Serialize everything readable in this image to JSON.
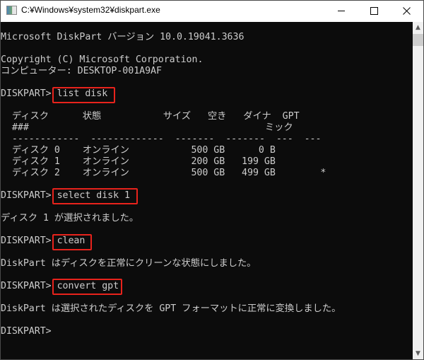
{
  "window": {
    "title": "C:¥Windows¥system32¥diskpart.exe",
    "icon": "console-app-icon",
    "controls": {
      "minimize": "minimize-icon",
      "maximize": "maximize-icon",
      "close": "close-icon"
    }
  },
  "console": {
    "lines": {
      "version": "Microsoft DiskPart バージョン 10.0.19041.3636",
      "copyright": "Copyright (C) Microsoft Corporation.",
      "computer": "コンピューター: DESKTOP-001A9AF",
      "prompt": "DISKPART> ",
      "table_header1": "  ディスク      状態           サイズ   空き   ダイナ  GPT",
      "table_header2": "  ###                                          ミック",
      "table_sep": "  ------------  -------------  -------  -------  ---  ---",
      "row0": "  ディスク 0    オンライン           500 GB      0 B",
      "row1": "  ディスク 1    オンライン           200 GB   199 GB",
      "row2": "  ディスク 2    オンライン           500 GB   499 GB        *",
      "select_result": "ディスク 1 が選択されました。",
      "clean_result": "DiskPart はディスクを正常にクリーンな状態にしました。",
      "convert_result": "DiskPart は選択されたディスクを GPT フォーマットに正常に変換しました。"
    },
    "commands": [
      "list disk",
      "select disk 1",
      "clean",
      "convert gpt"
    ],
    "disks": {
      "columns": [
        "ディスク ###",
        "状態",
        "サイズ",
        "空き",
        "ダイナミック",
        "GPT"
      ],
      "rows": [
        {
          "disk": "ディスク 0",
          "status": "オンライン",
          "size": "500 GB",
          "free": "0 B",
          "dyn": "",
          "gpt": ""
        },
        {
          "disk": "ディスク 1",
          "status": "オンライン",
          "size": "200 GB",
          "free": "199 GB",
          "dyn": "",
          "gpt": ""
        },
        {
          "disk": "ディスク 2",
          "status": "オンライン",
          "size": "500 GB",
          "free": "499 GB",
          "dyn": "",
          "gpt": "*"
        }
      ]
    },
    "highlight_color": "#e8231c",
    "text_color": "#cccccc",
    "background_color": "#0c0c0c"
  },
  "scrollbar": {
    "up": "▲",
    "down": "▼"
  }
}
